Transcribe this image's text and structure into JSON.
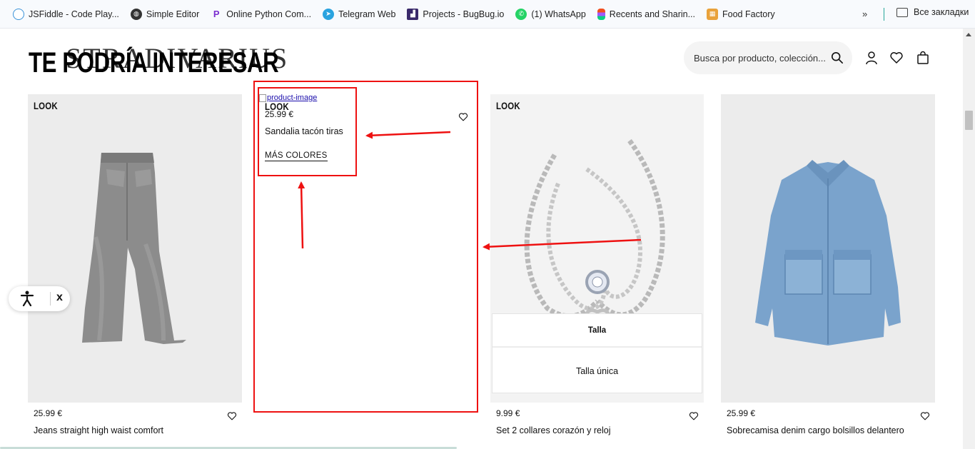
{
  "bookmarks": {
    "items": [
      {
        "label": "JSFiddle - Code Play...",
        "icon": "jsfiddle-icon",
        "color": "#3a92d8"
      },
      {
        "label": "Simple Editor",
        "icon": "globe-icon",
        "color": "#333333"
      },
      {
        "label": "Online Python Com...",
        "icon": "python-icon",
        "color": "#7b2fd0"
      },
      {
        "label": "Telegram Web",
        "icon": "telegram-icon",
        "color": "#2aa3df"
      },
      {
        "label": "Projects - BugBug.io",
        "icon": "bugbug-icon",
        "color": "#3a2a6b"
      },
      {
        "label": "(1) WhatsApp",
        "icon": "whatsapp-icon",
        "color": "#25d366"
      },
      {
        "label": "Recents and Sharin...",
        "icon": "figma-icon",
        "color": "#f24e1e"
      },
      {
        "label": "Food Factory",
        "icon": "food-factory-icon",
        "color": "#e9a23b"
      }
    ],
    "more": "»",
    "all_bookmarks": "Все закладки"
  },
  "header": {
    "logo": "STRADIVARIUS",
    "heading": "TE PODRÍA INTERESAR",
    "search_placeholder": "Busca por producto, colección..."
  },
  "products": [
    {
      "badge": "LOOK",
      "price": "25.99 €",
      "name": "Jeans straight high waist comfort"
    },
    {
      "badge": "LOOK",
      "price": "25.99 €",
      "name": "Sandalia tacón tiras",
      "broken_image_alt": "product-image",
      "more_colors": "MÁS COLORES"
    },
    {
      "badge": "LOOK",
      "price": "9.99 €",
      "name": "Set 2 collares corazón y reloj",
      "size_label": "Talla",
      "size_option": "Talla única"
    },
    {
      "price": "25.99 €",
      "name": "Sobrecamisa denim cargo bolsillos delantero"
    }
  ],
  "accessibility": {
    "close": "x"
  },
  "colors": {
    "annotation": "#e11111",
    "card_bg": "#ececec",
    "denim": "#7aa3cc"
  }
}
